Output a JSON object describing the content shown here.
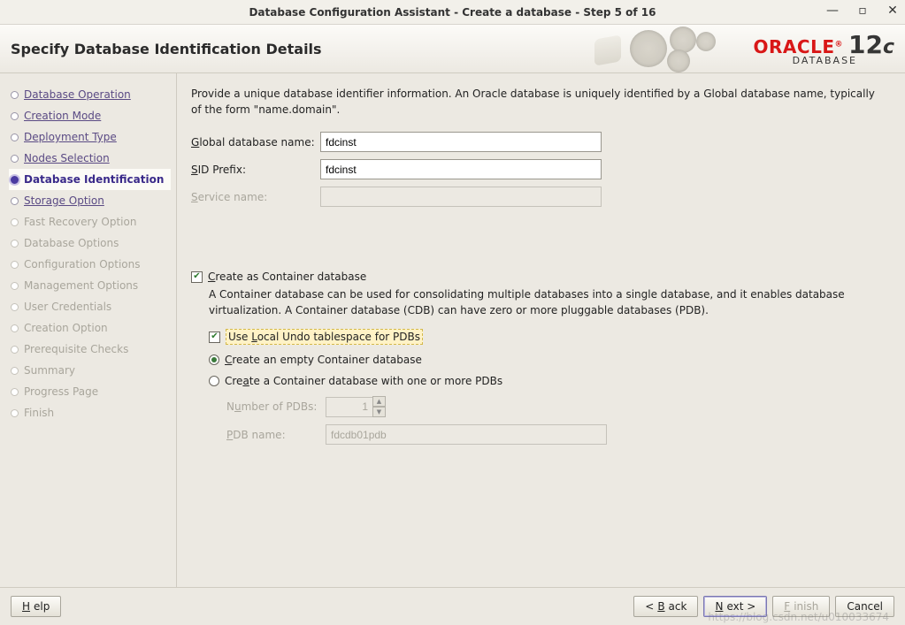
{
  "window": {
    "title": "Database Configuration Assistant - Create a database - Step 5 of 16"
  },
  "header": {
    "page_title": "Specify Database Identification Details",
    "brand_word": "ORACLE",
    "brand_version": "12",
    "brand_letter": "c",
    "brand_sub": "DATABASE"
  },
  "sidebar": {
    "steps": [
      {
        "label": "Database Operation",
        "state": "visited"
      },
      {
        "label": "Creation Mode",
        "state": "visited"
      },
      {
        "label": "Deployment Type",
        "state": "visited"
      },
      {
        "label": "Nodes Selection",
        "state": "visited"
      },
      {
        "label": "Database Identification",
        "state": "current"
      },
      {
        "label": "Storage Option",
        "state": "visited"
      },
      {
        "label": "Fast Recovery Option",
        "state": "future"
      },
      {
        "label": "Database Options",
        "state": "future"
      },
      {
        "label": "Configuration Options",
        "state": "future"
      },
      {
        "label": "Management Options",
        "state": "future"
      },
      {
        "label": "User Credentials",
        "state": "future"
      },
      {
        "label": "Creation Option",
        "state": "future"
      },
      {
        "label": "Prerequisite Checks",
        "state": "future"
      },
      {
        "label": "Summary",
        "state": "future"
      },
      {
        "label": "Progress Page",
        "state": "future"
      },
      {
        "label": "Finish",
        "state": "future"
      }
    ]
  },
  "main": {
    "intro": "Provide a unique database identifier information. An Oracle database is uniquely identified by a Global database name, typically of the form \"name.domain\".",
    "global_db_label_u": "G",
    "global_db_label_rest": "lobal database name:",
    "global_db_value": "fdcinst",
    "sid_label_u": "S",
    "sid_label_rest": "ID Prefix:",
    "sid_value": "fdcinst",
    "service_label_u": "S",
    "service_label_rest": "ervice name:",
    "service_value": "",
    "create_container_u": "C",
    "create_container_rest": "reate as Container database",
    "container_desc": "A Container database can be used for consolidating multiple databases into a single database, and it enables database virtualization. A Container database (CDB) can have zero or more pluggable databases (PDB).",
    "local_undo_pre": "Use ",
    "local_undo_u": "L",
    "local_undo_rest": "ocal Undo tablespace for PDBs",
    "empty_cdb_u": "C",
    "empty_cdb_rest": "reate an empty Container database",
    "with_pdbs_pre": "Cre",
    "with_pdbs_u": "a",
    "with_pdbs_rest": "te a Container database with one or more PDBs",
    "num_pdbs_pre": "N",
    "num_pdbs_u": "u",
    "num_pdbs_rest": "mber of PDBs:",
    "num_pdbs_value": "1",
    "pdb_name_u": "P",
    "pdb_name_rest": "DB name:",
    "pdb_name_value": "fdcdb01pdb"
  },
  "footer": {
    "help_u": "H",
    "help_rest": "elp",
    "back_sym": "<",
    "back_u": "B",
    "back_rest": "ack",
    "next_u": "N",
    "next_rest": "ext >",
    "finish_u": "F",
    "finish_rest": "inish",
    "cancel": "Cancel"
  },
  "watermark": "https://blog.csdn.net/u010033674"
}
